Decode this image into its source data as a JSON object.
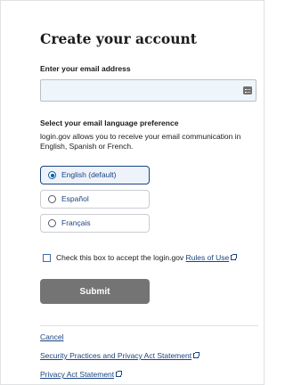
{
  "page": {
    "title": "Create your account"
  },
  "email": {
    "label": "Enter your email address",
    "value": "",
    "placeholder": ""
  },
  "language": {
    "heading": "Select your email language preference",
    "description": "login.gov allows you to receive your email communication in English, Spanish or French.",
    "options": [
      {
        "label": "English (default)",
        "selected": true
      },
      {
        "label": "Español",
        "selected": false
      },
      {
        "label": "Français",
        "selected": false
      }
    ]
  },
  "terms": {
    "text": "Check this box to accept the login.gov",
    "link": "Rules of Use",
    "checked": false
  },
  "submit_label": "Submit",
  "footer": {
    "cancel": "Cancel",
    "security_link": "Security Practices and Privacy Act Statement",
    "privacy_link": "Privacy Act Statement"
  },
  "colors": {
    "link": "#1a4480",
    "button": "#747474",
    "input_bg": "#eef5fb"
  }
}
